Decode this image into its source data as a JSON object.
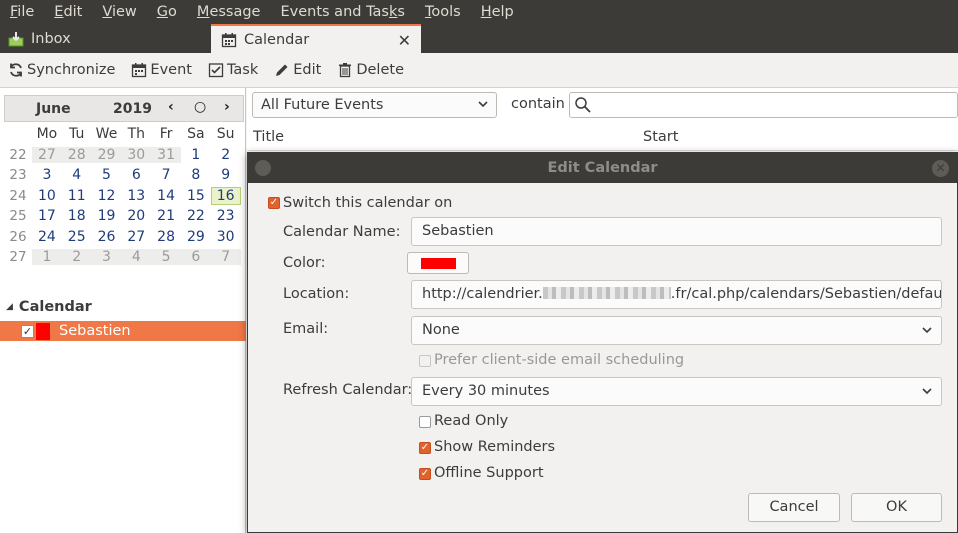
{
  "menubar": {
    "items": [
      {
        "u": "F",
        "rest": "ile"
      },
      {
        "u": "E",
        "rest": "dit"
      },
      {
        "u": "V",
        "rest": "iew"
      },
      {
        "u": "G",
        "rest": "o"
      },
      {
        "u": "M",
        "rest": "essage"
      },
      {
        "u": "",
        "pre": "Events and Tas",
        "u2": "k",
        "rest": "s"
      },
      {
        "u": "T",
        "rest": "ools"
      },
      {
        "u": "H",
        "rest": "elp"
      }
    ]
  },
  "tabs": {
    "inbox": "Inbox",
    "calendar": "Calendar",
    "close": "✕"
  },
  "toolbar": {
    "synchronize": "Synchronize",
    "event": "Event",
    "task": "Task",
    "edit": "Edit",
    "delete": "Delete"
  },
  "minimonth": {
    "month": "June",
    "year": "2019",
    "prev": "‹",
    "today": "○",
    "next": "›",
    "daynames": [
      "Mo",
      "Tu",
      "We",
      "Th",
      "Fr",
      "Sa",
      "Su"
    ],
    "weeks": [
      {
        "wk": "22",
        "days": [
          "27",
          "28",
          "29",
          "30",
          "31",
          "1",
          "2"
        ],
        "other": [
          0,
          1,
          2,
          3,
          4
        ]
      },
      {
        "wk": "23",
        "days": [
          "3",
          "4",
          "5",
          "6",
          "7",
          "8",
          "9"
        ],
        "other": []
      },
      {
        "wk": "24",
        "days": [
          "10",
          "11",
          "12",
          "13",
          "14",
          "15",
          "16"
        ],
        "other": [],
        "today": 6
      },
      {
        "wk": "25",
        "days": [
          "17",
          "18",
          "19",
          "20",
          "21",
          "22",
          "23"
        ],
        "other": []
      },
      {
        "wk": "26",
        "days": [
          "24",
          "25",
          "26",
          "27",
          "28",
          "29",
          "30"
        ],
        "other": []
      },
      {
        "wk": "27",
        "days": [
          "1",
          "2",
          "3",
          "4",
          "5",
          "6",
          "7"
        ],
        "other": [
          0,
          1,
          2,
          3,
          4,
          5,
          6
        ]
      }
    ]
  },
  "calendars": {
    "heading": "Calendar",
    "items": [
      {
        "name": "Sebastien",
        "color": "#ff0000",
        "checked": true
      }
    ]
  },
  "filter": {
    "selected": "All Future Events",
    "contain_label": "contain",
    "search_value": ""
  },
  "list": {
    "col_title": "Title",
    "col_start": "Start"
  },
  "dialog": {
    "title": "Edit Calendar",
    "switch_on_label": "Switch this calendar on",
    "name_label": "Calendar Name:",
    "name_value": "Sebastien",
    "color_label": "Color:",
    "color_value": "#ff0000",
    "location_label": "Location:",
    "location_prefix": "http://calendrier.",
    "location_suffix": ".fr/cal.php/calendars/Sebastien/default/",
    "email_label": "Email:",
    "email_value": "None",
    "prefer_client_label": "Prefer client-side email scheduling",
    "refresh_label": "Refresh Calendar:",
    "refresh_value": "Every 30 minutes",
    "read_only_label": "Read Only",
    "show_reminders_label": "Show Reminders",
    "offline_support_label": "Offline Support",
    "cancel_label": "Cancel",
    "ok_label": "OK"
  },
  "colors": {
    "accent": "#f07746",
    "titlebar": "#3c3b37",
    "calendar_color": "#ff0000"
  }
}
